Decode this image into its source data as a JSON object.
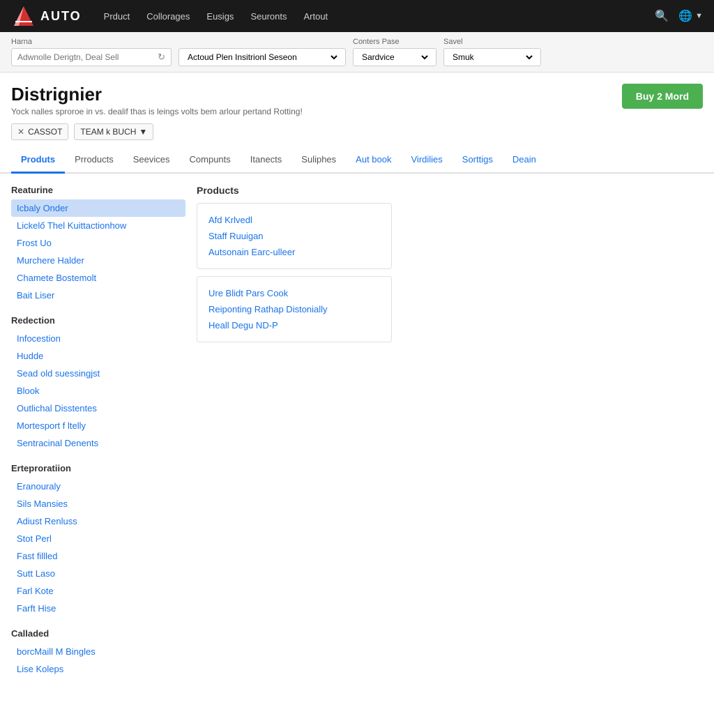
{
  "header": {
    "logo_text": "AUTO",
    "nav_items": [
      "Prduct",
      "Collorages",
      "Eusigs",
      "Seuronts",
      "Artout"
    ],
    "search_label": "search",
    "globe_label": "globe"
  },
  "filter_bar": {
    "name_label": "Harna",
    "name_placeholder": "Adwnolle Derigtn, Deal Sell",
    "dropdown1_placeholder": "Actoud Plen Insitrionl Seseon",
    "dropdown2_placeholder": "Sardvice",
    "dropdown3_placeholder": "Smuk",
    "conters_pase_label": "Conters Pase",
    "saved_label": "Savel"
  },
  "page_title": {
    "title": "Distrignier",
    "subtitle": "Yock nalles sproroe in vs. dealif thas is leings volts bem arlour pertand Rotting!",
    "buy_button": "Buy 2 Mord"
  },
  "tags": [
    {
      "label": "CASSOT",
      "has_x": true
    },
    {
      "label": "TEAM  k BUCH",
      "has_dropdown": true
    }
  ],
  "tabs": [
    {
      "label": "Produts",
      "active": true
    },
    {
      "label": "Prroducts",
      "active": false
    },
    {
      "label": "Seevices",
      "active": false
    },
    {
      "label": "Compunts",
      "active": false
    },
    {
      "label": "Itanects",
      "active": false
    },
    {
      "label": "Suliphes",
      "active": false
    },
    {
      "label": "Aut book",
      "active": false,
      "blue": true
    },
    {
      "label": "Virdilies",
      "active": false,
      "blue": true
    },
    {
      "label": "Sorttigs",
      "active": false,
      "blue": true
    },
    {
      "label": "Deain",
      "active": false,
      "blue": true
    }
  ],
  "left_panel": {
    "sections": [
      {
        "title": "Reaturine",
        "items": [
          {
            "label": "Icbaly Onder",
            "selected": true
          },
          {
            "label": "Lickelő Thel Kuittactionhow",
            "selected": false
          },
          {
            "label": "Frost Uo",
            "selected": false
          },
          {
            "label": "Murchere Halder",
            "selected": false
          },
          {
            "label": "Chamete Bostemolt",
            "selected": false
          },
          {
            "label": "Bait Liser",
            "selected": false
          }
        ]
      },
      {
        "title": "Redection",
        "items": [
          {
            "label": "Infocestion",
            "selected": false
          },
          {
            "label": "Hudde",
            "selected": false
          },
          {
            "label": "Sead old suessingjst",
            "selected": false
          },
          {
            "label": "Blook",
            "selected": false
          },
          {
            "label": "Outlichal Disstentes",
            "selected": false
          },
          {
            "label": "Mortesport f ltelly",
            "selected": false
          },
          {
            "label": "Sentracinal Denents",
            "selected": false
          }
        ]
      },
      {
        "title": "Erteproratiion",
        "items": [
          {
            "label": "Eranouraly",
            "selected": false
          },
          {
            "label": "Sils Mansies",
            "selected": false
          },
          {
            "label": "Adiust Renluss",
            "selected": false
          },
          {
            "label": "Stot Perl",
            "selected": false
          },
          {
            "label": "Fast fillled",
            "selected": false
          },
          {
            "label": "Sutt Laso",
            "selected": false
          },
          {
            "label": "Farl Kote",
            "selected": false
          },
          {
            "label": "Farft Hise",
            "selected": false
          }
        ]
      },
      {
        "title": "Calladed",
        "items": [
          {
            "label": "borcMaill M Bingles",
            "selected": false
          },
          {
            "label": "Lise Koleps",
            "selected": false
          }
        ]
      }
    ]
  },
  "right_panel": {
    "title": "Products",
    "cards": [
      {
        "items": [
          "Afd Krlvedl",
          "Staff Ruuigan",
          "Autsonain Earc-ulleer"
        ]
      },
      {
        "items": [
          "Ure Blidt Pars Cook",
          "Reiponting Rathap Distonially",
          "Heall Degu ND-P"
        ]
      }
    ]
  }
}
